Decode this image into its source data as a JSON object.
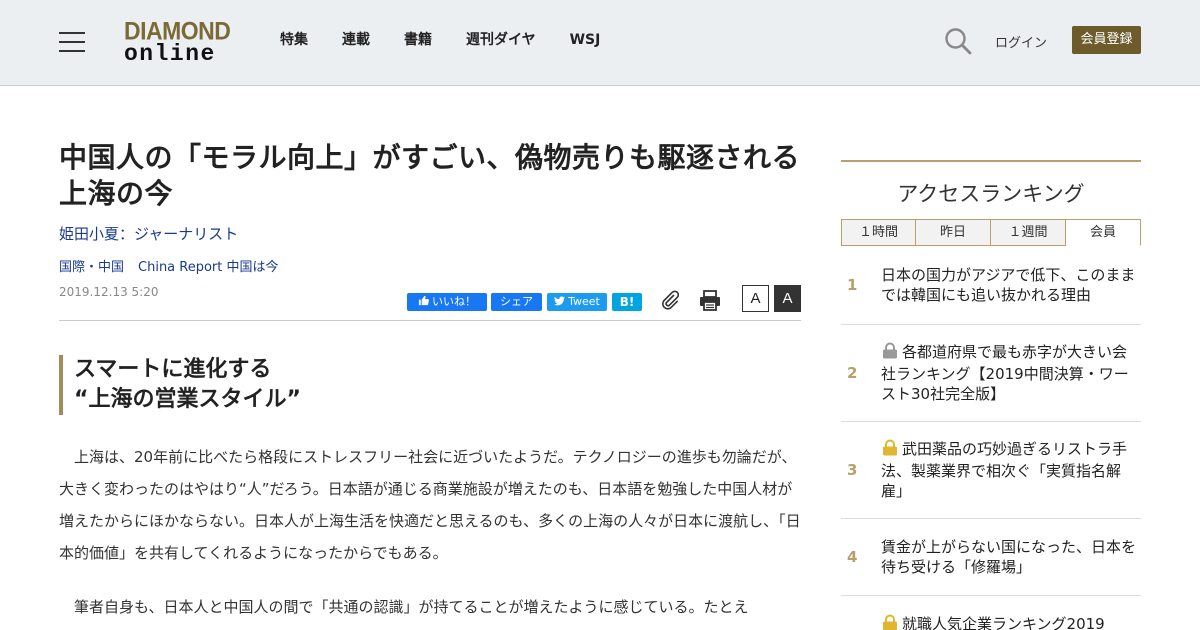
{
  "header": {
    "logo_top": "DIAMOND",
    "logo_bottom": "online",
    "nav": [
      "特集",
      "連載",
      "書籍",
      "週刊ダイヤ",
      "WSJ"
    ],
    "login_label": "ログイン",
    "register_label": "会員登録"
  },
  "article": {
    "title": "中国人の「モラル向上」がすごい、偽物売りも駆逐される上海の今",
    "author": "姫田小夏：ジャーナリスト",
    "categories": [
      "国際・中国",
      "China Report 中国は今"
    ],
    "date": "2019.12.13 5:20",
    "share": {
      "like": "いいね！",
      "share": "シェア",
      "tweet": "Tweet",
      "hatena": "B!"
    },
    "font_small": "A",
    "font_large": "A",
    "subhead_line1": "スマートに進化する",
    "subhead_line2": "“上海の営業スタイル”",
    "paragraph1": "上海は、20年前に比べたら格段にストレスフリー社会に近づいたようだ。テクノロジーの進歩も勿論だが、大きく変わったのはやはり“人”だろう。日本語が通じる商業施設が増えたのも、日本語を勉強した中国人材が増えたからにほかならない。日本人が上海生活を快適だと思えるのも、多くの上海の人々が日本に渡航し、「日本的価値」を共有してくれるようになったからでもある。",
    "paragraph2": "筆者自身も、日本人と中国人の間で「共通の認識」が持てることが増えたように感じている。たとえ"
  },
  "sidebar": {
    "ranking_title": "アクセスランキング",
    "tabs": [
      "１時間",
      "昨日",
      "１週間",
      "会員"
    ],
    "active_tab": "会員",
    "items": [
      {
        "num": "1",
        "text": "日本の国力がアジアで低下、このままでは韓国にも追い抜かれる理由",
        "lock": "none"
      },
      {
        "num": "2",
        "text": "各都道府県で最も赤字が大きい会社ランキング【2019中間決算・ワースト30社完全版】",
        "lock": "gray"
      },
      {
        "num": "3",
        "text": "武田薬品の巧妙過ぎるリストラ手法、製薬業界で相次ぐ「実質指名解雇」",
        "lock": "gold"
      },
      {
        "num": "4",
        "text": "賃金が上がらない国になった、日本を待ち受ける「修羅場」",
        "lock": "none"
      },
      {
        "num": "5",
        "text": "就職人気企業ランキング2019",
        "lock": "gold"
      }
    ]
  },
  "colors": {
    "accent_gold": "#b8a06a",
    "register_bg": "#6e5b2c",
    "link_blue": "#1a3a8f",
    "header_bg": "#eceff2"
  }
}
